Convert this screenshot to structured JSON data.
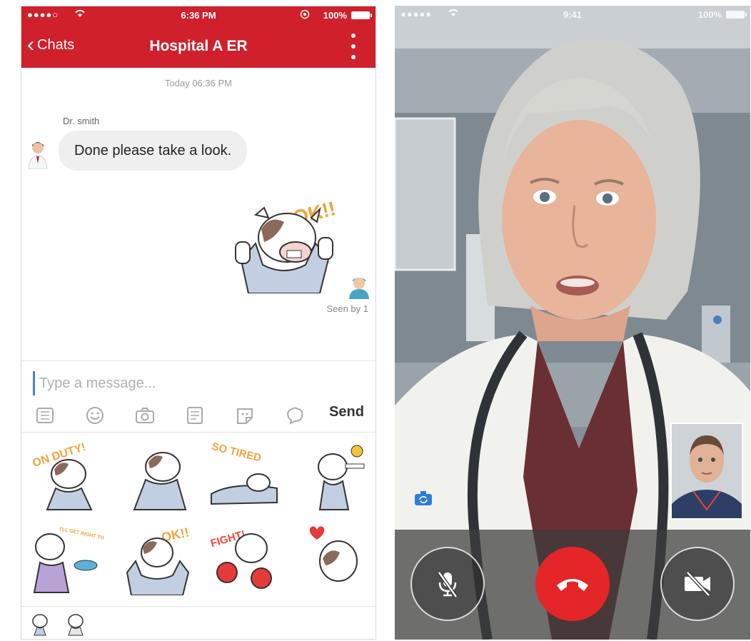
{
  "chat_phone": {
    "status_bar": {
      "signal": "●●●●○",
      "time": "6:36 PM",
      "battery": "100%"
    },
    "nav": {
      "back_label": "Chats",
      "title": "Hospital A ER"
    },
    "timestamp": "Today  06:36 PM",
    "message": {
      "sender": "Dr. smith",
      "text": "Done please take a look."
    },
    "sticker_text": "OK!!",
    "seen_label": "Seen by 1",
    "input": {
      "placeholder": "Type a message...",
      "value": ""
    },
    "toolbar": {
      "icons": [
        "keyboard-icon",
        "emoji-icon",
        "camera-icon",
        "gallery-icon",
        "sticker-icon",
        "brain-icon"
      ],
      "send_label": "Send"
    },
    "stickers": [
      {
        "name": "sticker-on-duty",
        "text": "ON DUTY!"
      },
      {
        "name": "sticker-sad-cow",
        "text": ""
      },
      {
        "name": "sticker-so-tired",
        "text": "SO TIRED"
      },
      {
        "name": "sticker-injection",
        "text": ""
      },
      {
        "name": "sticker-right-to-your-desk",
        "text": "I'LL GET RIGHT TO YOUR DESK"
      },
      {
        "name": "sticker-ok",
        "text": "OK!!"
      },
      {
        "name": "sticker-fight",
        "text": "FIGHT!"
      },
      {
        "name": "sticker-love",
        "text": ""
      }
    ]
  },
  "video_phone": {
    "status_bar": {
      "signal": "●●●●●",
      "time": "9:41",
      "battery": "100%"
    },
    "controls": {
      "mute_icon": "mic-off-icon",
      "end_icon": "end-call-icon",
      "video_icon": "video-off-icon",
      "switch_icon": "camera-switch-icon"
    }
  },
  "colors": {
    "brand_red": "#d0202c",
    "end_call_red": "#e52628",
    "input_cursor_blue": "#4a80d8"
  }
}
